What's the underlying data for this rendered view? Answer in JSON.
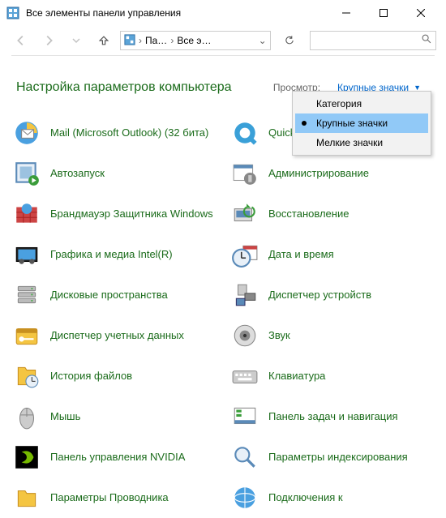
{
  "window": {
    "title": "Все элементы панели управления"
  },
  "address": {
    "crumb1": "Па…",
    "crumb2": "Все э…"
  },
  "heading": "Настройка параметров компьютера",
  "view": {
    "label": "Просмотр:",
    "button": "Крупные значки"
  },
  "menu": {
    "items": [
      {
        "label": "Категория"
      },
      {
        "label": "Крупные значки"
      },
      {
        "label": "Мелкие значки"
      }
    ]
  },
  "items": [
    {
      "label": "Mail (Microsoft Outlook) (32 бита)"
    },
    {
      "label": "QuickTime"
    },
    {
      "label": "Автозапуск"
    },
    {
      "label": "Администрирование"
    },
    {
      "label": "Брандмауэр Защитника Windows"
    },
    {
      "label": "Восстановление"
    },
    {
      "label": "Графика и медиа Intel(R)"
    },
    {
      "label": "Дата и время"
    },
    {
      "label": "Дисковые пространства"
    },
    {
      "label": "Диспетчер устройств"
    },
    {
      "label": "Диспетчер учетных данных"
    },
    {
      "label": "Звук"
    },
    {
      "label": "История файлов"
    },
    {
      "label": "Клавиатура"
    },
    {
      "label": "Мышь"
    },
    {
      "label": "Панель задач и навигация"
    },
    {
      "label": "Панель управления NVIDIA"
    },
    {
      "label": "Параметры индексирования"
    },
    {
      "label": "Параметры Проводника"
    },
    {
      "label": "Подключения к"
    }
  ]
}
